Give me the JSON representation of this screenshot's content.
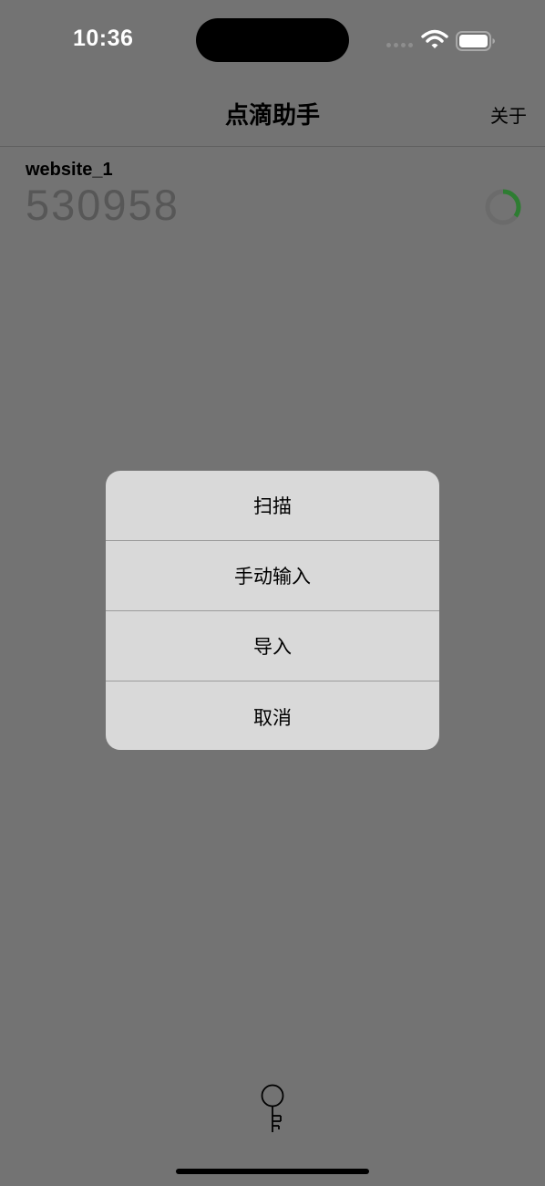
{
  "status_bar": {
    "time": "10:36"
  },
  "nav": {
    "title": "点滴助手",
    "about_label": "关于"
  },
  "account": {
    "name": "website_1",
    "code": "530958",
    "countdown_fraction": 0.35
  },
  "action_sheet": {
    "items": [
      {
        "label": "扫描"
      },
      {
        "label": "手动输入"
      },
      {
        "label": "导入"
      },
      {
        "label": "取消"
      }
    ]
  },
  "icons": {
    "wifi": "wifi-icon",
    "battery": "battery-icon",
    "cell": "cell-signal-icon",
    "key": "key-icon",
    "countdown": "countdown-ring-icon"
  },
  "colors": {
    "overlay_background": "#737373",
    "sheet_background": "#d9d9d9",
    "countdown_ring": "#2e7d32",
    "code_text": "#575757"
  }
}
